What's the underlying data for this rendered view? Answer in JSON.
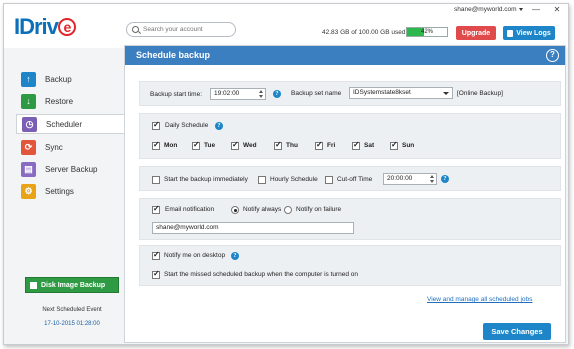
{
  "app": {
    "logo_text": "IDriv",
    "logo_e": "e"
  },
  "header": {
    "user": "shane@myworld.com",
    "search_placeholder": "Search your account",
    "storage_text": "42.83 GB of 100.00 GB used",
    "usage_percent": 42,
    "usage_label": "42%",
    "upgrade_label": "Upgrade",
    "view_logs_label": "View Logs",
    "window_controls": [
      "—",
      "✕"
    ]
  },
  "sidebar": {
    "items": [
      {
        "label": "Backup",
        "icon": "backup-icon",
        "color": "#1e86c8",
        "glyph": "↑"
      },
      {
        "label": "Restore",
        "icon": "restore-icon",
        "color": "#2e9a43",
        "glyph": "↓"
      },
      {
        "label": "Scheduler",
        "icon": "scheduler-icon",
        "color": "#7a5fb5",
        "glyph": "◷"
      },
      {
        "label": "Sync",
        "icon": "sync-icon",
        "color": "#e2573b",
        "glyph": "⟳"
      },
      {
        "label": "Server Backup",
        "icon": "server-backup-icon",
        "color": "#8a6bc2",
        "glyph": "▤"
      },
      {
        "label": "Settings",
        "icon": "gear-icon",
        "color": "#e8a317",
        "glyph": "⚙"
      }
    ],
    "active_index": 2,
    "disk_image_label": "Disk Image Backup",
    "next_event_label": "Next Scheduled Event",
    "next_event_value": "17-10-2015 01:28:00"
  },
  "main": {
    "title": "Schedule backup",
    "help_glyph": "?",
    "start_time_label": "Backup start time:",
    "start_time_value": "19:02:00",
    "backup_set_label": "Backup set name",
    "backup_set_value": "IDSystemstate8kset",
    "backup_set_type": "[Online Backup]",
    "daily_schedule_label": "Daily Schedule",
    "days": [
      "Mon",
      "Tue",
      "Wed",
      "Thu",
      "Fri",
      "Sat",
      "Sun"
    ],
    "start_immediately_label": "Start the backup immediately",
    "hourly_label": "Hourly Schedule",
    "cutoff_label": "Cut-off Time",
    "cutoff_value": "20:00:00",
    "email_label": "Email notification",
    "notify_always_label": "Notify always",
    "notify_failure_label": "Notify on failure",
    "email_value": "shane@myworld.com",
    "notify_desktop_label": "Notify me on desktop",
    "missed_label": "Start the missed scheduled backup when the computer is turned on",
    "view_all_link": "View and manage all scheduled jobs",
    "save_label": "Save Changes",
    "info_glyph": "?"
  }
}
